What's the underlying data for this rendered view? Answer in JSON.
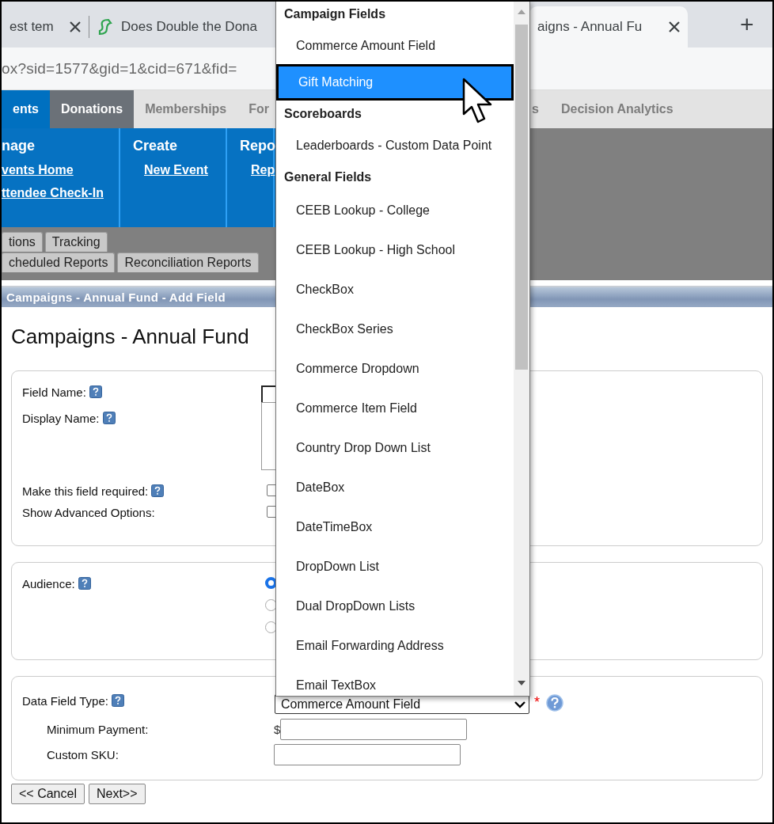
{
  "browser_tabs": [
    {
      "title": "est tem",
      "selected": false,
      "closable": true,
      "kind": "plain"
    },
    {
      "title": "Does Double the Dona",
      "selected": false,
      "closable": false,
      "kind": "favicon"
    },
    {
      "title": "aigns - Annual Fu",
      "selected": true,
      "closable": true,
      "kind": "plain"
    }
  ],
  "new_tab": "+",
  "address": "ox?sid=1577&gid=1&cid=671&fid=",
  "nav_left": [
    {
      "label": "ents",
      "selected": false,
      "kind": "module"
    },
    {
      "label": "Donations",
      "selected": true,
      "kind": "tab"
    },
    {
      "label": "Memberships",
      "selected": false,
      "kind": "tab"
    },
    {
      "label": "For",
      "selected": false,
      "kind": "tab"
    }
  ],
  "nav_right": [
    {
      "label": "s",
      "selected": false,
      "kind": "tab"
    },
    {
      "label": "Decision Analytics",
      "selected": false,
      "kind": "tab"
    }
  ],
  "menu_sections": [
    {
      "heading": "nage",
      "links": [
        "vents Home",
        "ttendee Check-In"
      ]
    },
    {
      "heading": "Create",
      "links": [
        "New Event"
      ]
    },
    {
      "heading": "Repo",
      "links": [
        "Rep"
      ]
    }
  ],
  "subtab_rows": [
    [
      {
        "label": "tions",
        "selected": false
      },
      {
        "label": "Tracking",
        "selected": false
      }
    ],
    [
      {
        "label": "cheduled Reports",
        "selected": false
      },
      {
        "label": "Reconciliation Reports",
        "selected": false
      }
    ]
  ],
  "title_bar": "Campaigns - Annual Fund - Add Field",
  "heading": "Campaigns - Annual Fund",
  "general_section": {
    "fields": [
      {
        "label": "Field Name:",
        "help": true,
        "kind": "input"
      },
      {
        "label": "Display Name:",
        "help": true,
        "kind": "textarea"
      },
      {
        "label": "Make this field required:",
        "help": true,
        "kind": "checkbox",
        "checked": false
      },
      {
        "label": "Show Advanced Options:",
        "help": false,
        "kind": "checkbox",
        "checked": false
      }
    ]
  },
  "audience_section": {
    "label": "Audience:",
    "help": true,
    "radios": [
      {
        "selected": true
      },
      {
        "selected": false
      },
      {
        "selected": false
      }
    ]
  },
  "type_section": {
    "label": "Data Field Type:",
    "help": true,
    "value": "Commerce Amount Field",
    "required_mark": "*",
    "sub_fields": [
      {
        "label": "Minimum Payment:",
        "prefix": "$"
      },
      {
        "label": "Custom SKU:"
      }
    ]
  },
  "buttons": [
    "<< Cancel",
    "Next>>"
  ],
  "dropdown": {
    "groups": [
      {
        "header": "Campaign Fields",
        "options": [
          {
            "label": "Commerce Amount Field",
            "selected": false
          },
          {
            "label": "Gift Matching",
            "selected": true
          }
        ]
      },
      {
        "header": "Scoreboards",
        "options": [
          {
            "label": "Leaderboards - Custom Data Point",
            "selected": false
          }
        ]
      },
      {
        "header": "General Fields",
        "options": [
          {
            "label": "CEEB Lookup - College",
            "selected": false
          },
          {
            "label": "CEEB Lookup - High School",
            "selected": false
          },
          {
            "label": "CheckBox",
            "selected": false
          },
          {
            "label": "CheckBox Series",
            "selected": false
          },
          {
            "label": "Commerce Dropdown",
            "selected": false
          },
          {
            "label": "Commerce Item Field",
            "selected": false
          },
          {
            "label": "Country Drop Down List",
            "selected": false
          },
          {
            "label": "DateBox",
            "selected": false
          },
          {
            "label": "DateTimeBox",
            "selected": false
          },
          {
            "label": "DropDown List",
            "selected": false
          },
          {
            "label": "Dual DropDown Lists",
            "selected": false
          },
          {
            "label": "Email Forwarding Address",
            "selected": false
          },
          {
            "label": "Email TextBox",
            "selected": false
          }
        ]
      }
    ]
  }
}
